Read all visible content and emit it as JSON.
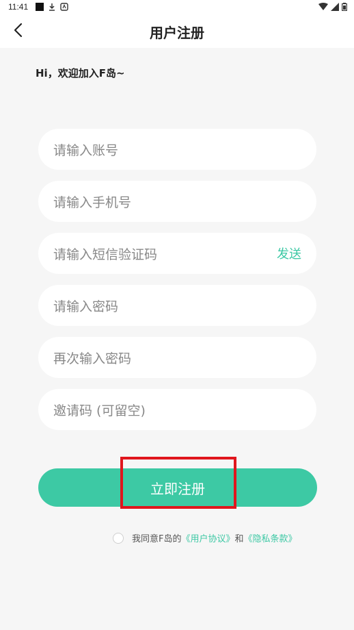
{
  "status_bar": {
    "time": "11:41"
  },
  "nav": {
    "title": "用户注册"
  },
  "welcome_text": "Hi，欢迎加入F岛~",
  "form": {
    "account_placeholder": "请输入账号",
    "phone_placeholder": "请输入手机号",
    "sms_code_placeholder": "请输入短信验证码",
    "send_code_label": "发送",
    "password_placeholder": "请输入密码",
    "confirm_password_placeholder": "再次输入密码",
    "invite_code_placeholder": "邀请码 (可留空)"
  },
  "register_button_label": "立即注册",
  "agreement": {
    "prefix": "我同意F岛的",
    "user_agreement": "《用户协议》",
    "conjunction": "和",
    "privacy_policy": "《隐私条款》"
  },
  "colors": {
    "accent": "#3dc9a4",
    "highlight": "#e0161d",
    "background": "#f6f6f6"
  }
}
